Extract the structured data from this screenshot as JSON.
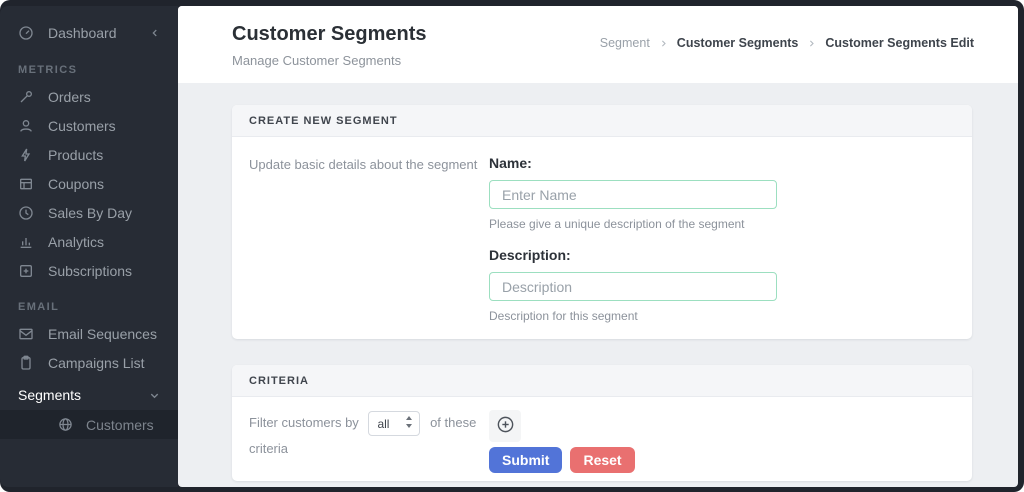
{
  "sidebar": {
    "dashboard": {
      "label": "Dashboard"
    },
    "groups": [
      {
        "label": "METRICS",
        "items": [
          {
            "label": "Orders",
            "icon": "wrench-icon"
          },
          {
            "label": "Customers",
            "icon": "user-icon"
          },
          {
            "label": "Products",
            "icon": "bolt-icon"
          },
          {
            "label": "Coupons",
            "icon": "table-icon"
          },
          {
            "label": "Sales By Day",
            "icon": "clock-icon"
          },
          {
            "label": "Analytics",
            "icon": "bar-chart-icon"
          },
          {
            "label": "Subscriptions",
            "icon": "plus-square-icon"
          }
        ]
      },
      {
        "label": "EMAIL",
        "items": [
          {
            "label": "Email Sequences",
            "icon": "envelope-icon"
          },
          {
            "label": "Campaigns List",
            "icon": "clipboard-icon"
          }
        ]
      }
    ],
    "segments": {
      "label": "Segments"
    },
    "segments_children": [
      {
        "label": "Customers",
        "icon": "globe-icon",
        "active": true
      }
    ]
  },
  "header": {
    "title": "Customer Segments",
    "subtitle": "Manage Customer Segments",
    "breadcrumb": [
      {
        "label": "Segment"
      },
      {
        "label": "Customer Segments"
      },
      {
        "label": "Customer Segments Edit"
      }
    ]
  },
  "create_segment_card": {
    "header": "CREATE NEW SEGMENT",
    "side_note": "Update basic details about the segment",
    "name_field": {
      "label": "Name:",
      "placeholder": "Enter Name",
      "helper": "Please give a unique description of the segment"
    },
    "description_field": {
      "label": "Description:",
      "placeholder": "Description",
      "helper": "Description for this segment"
    }
  },
  "criteria_card": {
    "header": "CRITERIA",
    "filter_text_before": "Filter customers by",
    "select_value": "all",
    "filter_text_after": "of these criteria",
    "submit_label": "Submit",
    "reset_label": "Reset"
  },
  "colors": {
    "sidebar_bg": "#272c35",
    "sidebar_active_bg": "#1f242c",
    "content_bg": "#edeff2",
    "card_header_bg": "#f5f6f8",
    "input_border_green": "#9cdfc0",
    "accent_blue": "#5274d8",
    "accent_red": "#e97070"
  }
}
